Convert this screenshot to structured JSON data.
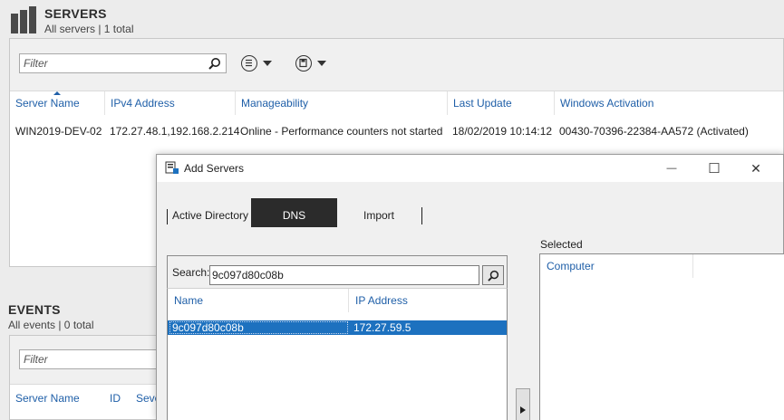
{
  "servers": {
    "title": "SERVERS",
    "subtitle": "All servers | 1 total",
    "filter_placeholder": "Filter",
    "columns": [
      "Server Name",
      "IPv4 Address",
      "Manageability",
      "Last Update",
      "Windows Activation"
    ],
    "rows": [
      {
        "server_name": "WIN2019-DEV-02",
        "ipv4": "172.27.48.1,192.168.2.214",
        "manageability": "Online - Performance counters not started",
        "last_update": "18/02/2019 10:14:12",
        "activation": "00430-70396-22384-AA572 (Activated)"
      }
    ]
  },
  "events": {
    "title": "EVENTS",
    "subtitle": "All events | 0 total",
    "filter_placeholder": "Filter",
    "columns": [
      "Server Name",
      "ID",
      "Seve"
    ]
  },
  "dialog": {
    "title": "Add Servers",
    "tabs": [
      "Active Directory",
      "DNS",
      "Import"
    ],
    "active_tab": "DNS",
    "search_label": "Search:",
    "search_value": "9c097d80c08b",
    "results_columns": [
      "Name",
      "IP Address"
    ],
    "results": [
      {
        "name": "9c097d80c08b",
        "ip": "172.27.59.5"
      }
    ],
    "selected_label": "Selected",
    "selected_columns": [
      "Computer"
    ]
  },
  "window_controls": {
    "minimize": "—",
    "maximize": "☐",
    "close": "✕"
  },
  "colors": {
    "header_link": "#1f5fa8",
    "selection": "#1d71bf",
    "active_tab": "#2b2b2b"
  }
}
